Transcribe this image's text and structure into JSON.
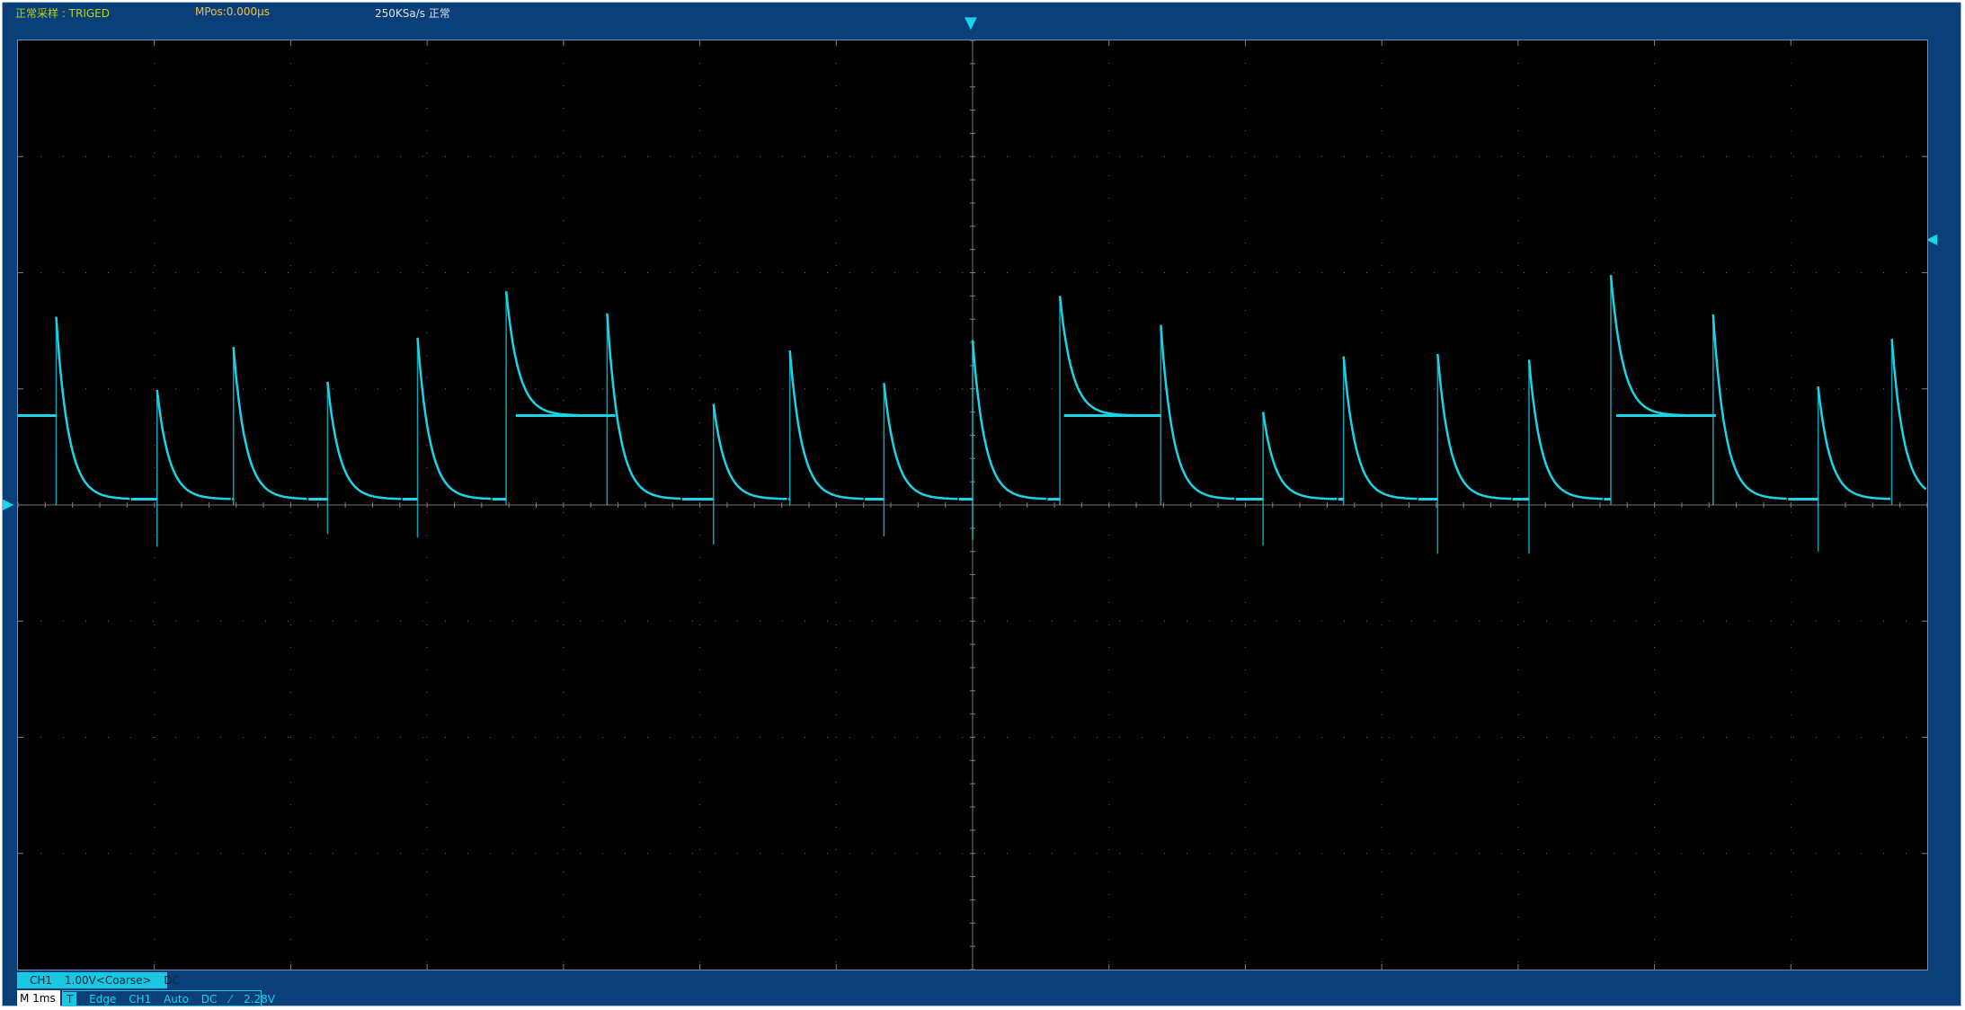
{
  "status": {
    "mode": "正常采样 : TRIGED",
    "mpos": "MPos:0.000μs",
    "sample_rate": "250KSa/s  正常"
  },
  "channel": {
    "name": "CH1",
    "scale": "1.00V<Coarse>",
    "coupling": "DC"
  },
  "timebase": "M 1ms",
  "trigger": {
    "label": "T",
    "type": "Edge",
    "source": "CH1",
    "mode": "Auto",
    "coupling": "DC",
    "slope": "⁄",
    "level": "2.28V"
  },
  "colors": {
    "trace": "#1ad5e8",
    "frame": "#0a3f7a",
    "grid": "#7f7f7f"
  },
  "chart_data": {
    "type": "line",
    "title": "",
    "xlabel": "",
    "ylabel": "",
    "divisions": {
      "x": 14,
      "y": 8
    },
    "xlim": [
      -7,
      7
    ],
    "ylim": [
      -4,
      4
    ],
    "x_unit": "div (1ms/div)",
    "y_unit": "div (1.00V/div)",
    "grid": true,
    "baseline": 0.05,
    "elevated_level": 0.77,
    "elevated_segments": [
      [
        -7.0,
        -6.72
      ],
      [
        -3.35,
        -2.62
      ],
      [
        0.67,
        1.38
      ],
      [
        4.72,
        5.45
      ]
    ],
    "spikes": [
      {
        "x": -6.72,
        "peak": 1.62,
        "undershoot": 0
      },
      {
        "x": -5.98,
        "peak": 0.99,
        "undershoot": -0.36
      },
      {
        "x": -5.42,
        "peak": 1.36,
        "undershoot": 0
      },
      {
        "x": -4.73,
        "peak": 1.06,
        "undershoot": -0.25
      },
      {
        "x": -4.07,
        "peak": 1.44,
        "undershoot": -0.28
      },
      {
        "x": -3.42,
        "peak": 1.84,
        "undershoot": 0
      },
      {
        "x": -2.68,
        "peak": 1.65,
        "undershoot": 0
      },
      {
        "x": -1.9,
        "peak": 0.87,
        "undershoot": -0.34
      },
      {
        "x": -1.34,
        "peak": 1.33,
        "undershoot": 0
      },
      {
        "x": -0.65,
        "peak": 1.05,
        "undershoot": -0.27
      },
      {
        "x": 0.0,
        "peak": 1.42,
        "undershoot": -0.3
      },
      {
        "x": 0.64,
        "peak": 1.8,
        "undershoot": 0
      },
      {
        "x": 1.38,
        "peak": 1.55,
        "undershoot": 0
      },
      {
        "x": 2.13,
        "peak": 0.8,
        "undershoot": -0.35
      },
      {
        "x": 2.72,
        "peak": 1.28,
        "undershoot": 0
      },
      {
        "x": 3.41,
        "peak": 1.3,
        "undershoot": -0.42
      },
      {
        "x": 4.08,
        "peak": 1.25,
        "undershoot": -0.42
      },
      {
        "x": 4.68,
        "peak": 1.98,
        "undershoot": 0
      },
      {
        "x": 5.43,
        "peak": 1.64,
        "undershoot": 0
      },
      {
        "x": 6.2,
        "peak": 1.02,
        "undershoot": -0.4
      },
      {
        "x": 6.74,
        "peak": 1.43,
        "undershoot": 0
      }
    ]
  }
}
